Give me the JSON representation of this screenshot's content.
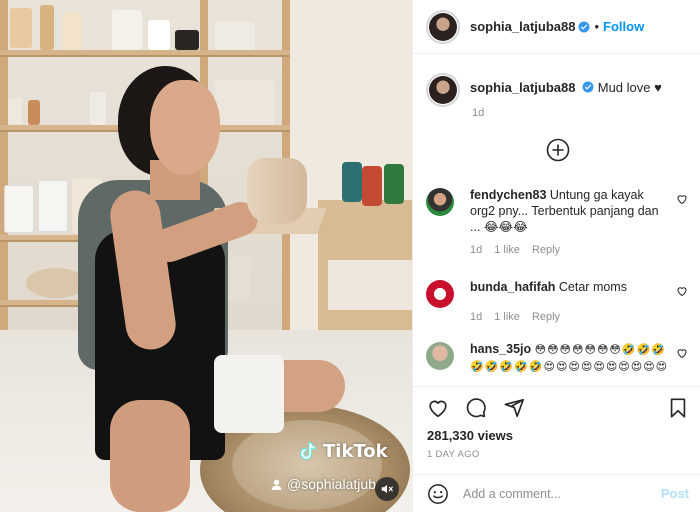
{
  "post": {
    "username": "sophia_latjuba88",
    "follow_label": "Follow",
    "dot": "•",
    "caption": "Mud love ♥",
    "caption_time": "1d",
    "views": "281,330 views",
    "time_ago": "1 DAY AGO",
    "add_comment_placeholder": "Add a comment...",
    "post_label": "Post"
  },
  "media": {
    "watermark_brand": "TikTok",
    "watermark_handle": "@sophialatjub"
  },
  "comments": [
    {
      "username": "fendychen83",
      "text": "Untung ga kayak org2 pny... Terbentuk panjang dan ... 😂😂😂",
      "time": "1d",
      "likes": "1 like",
      "reply": "Reply"
    },
    {
      "username": "bunda_hafifah",
      "text": "Cetar moms",
      "time": "1d",
      "likes": "1 like",
      "reply": "Reply"
    },
    {
      "username": "hans_35jo",
      "text": "😳😳😳😳😳😳😳🤣🤣🤣🤣🤣🤣🤣🤣😍😍😍😍😍😍😍😍😍😍",
      "time": "",
      "likes": "",
      "reply": ""
    }
  ],
  "icons": {
    "verified": "verified-badge-icon",
    "heart": "heart-icon",
    "comment": "comment-icon",
    "share": "share-icon",
    "bookmark": "bookmark-icon",
    "emoji": "emoji-icon",
    "load_more": "plus-circle-icon",
    "mute": "mute-icon"
  },
  "colors": {
    "link_blue": "#0095f6",
    "post_disabled": "#b2dffc",
    "verified_blue": "#3897f0"
  }
}
